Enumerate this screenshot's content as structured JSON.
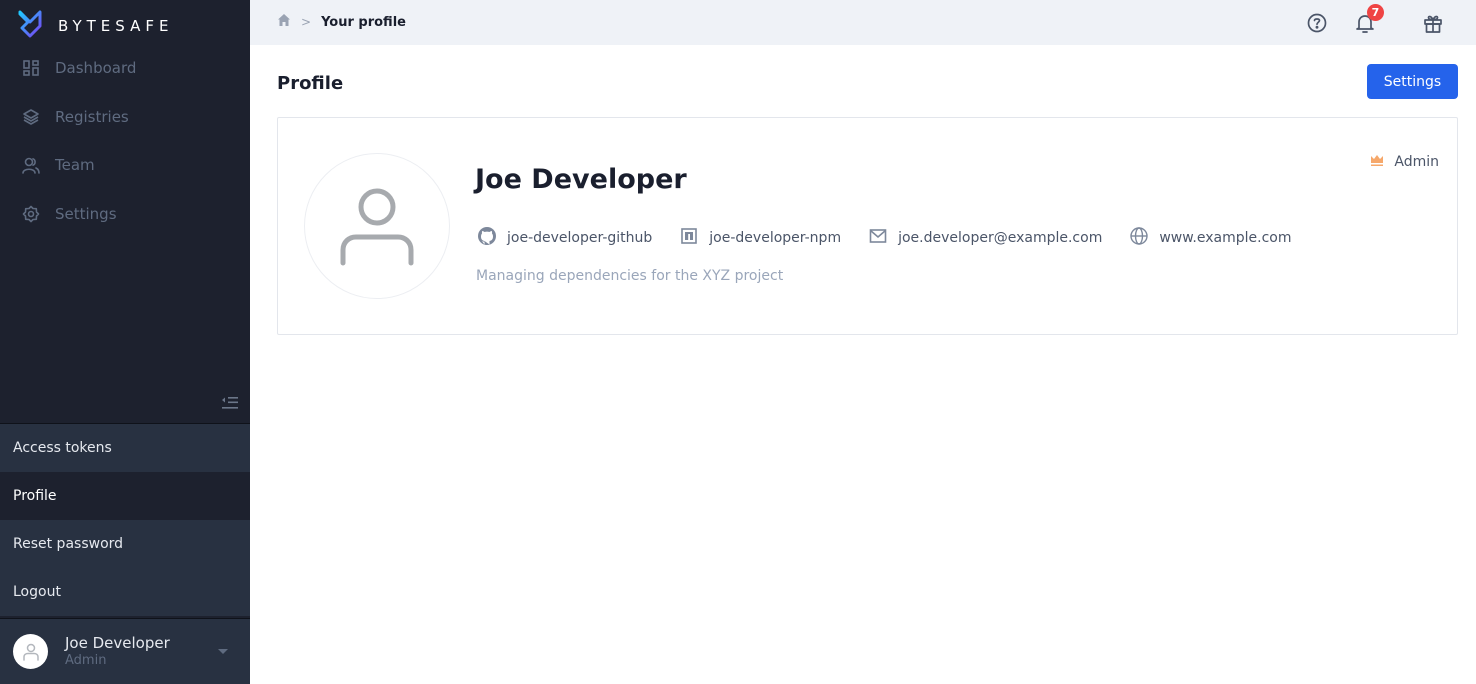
{
  "app": {
    "name": "BYTESAFE",
    "brand_colors": {
      "logo_start": "#1fc8ff",
      "logo_end": "#7b3ff2",
      "sidebar_bg": "#1d212e",
      "primary": "#2563eb",
      "badge": "#ef4444",
      "admin_icon": "#f6a86b"
    }
  },
  "sidebar": {
    "nav": [
      {
        "label": "Dashboard",
        "icon": "dashboard-icon"
      },
      {
        "label": "Registries",
        "icon": "layers-icon"
      },
      {
        "label": "Team",
        "icon": "team-icon"
      },
      {
        "label": "Settings",
        "icon": "gear-icon"
      }
    ],
    "collapse_icon": "collapse-sidebar-icon",
    "user_menu": [
      {
        "label": "Access tokens",
        "active": false
      },
      {
        "label": "Profile",
        "active": true
      },
      {
        "label": "Reset password",
        "active": false
      },
      {
        "label": "Logout",
        "active": false
      }
    ],
    "user": {
      "name": "Joe Developer",
      "role": "Admin"
    }
  },
  "topbar": {
    "breadcrumb": {
      "home_icon": "home-icon",
      "separator": ">",
      "current": "Your profile"
    },
    "icons": [
      "help-icon",
      "bell-icon",
      "gift-icon"
    ],
    "notification_count": "7"
  },
  "main": {
    "title": "Profile",
    "settings_label": "Settings",
    "profile": {
      "name": "Joe Developer",
      "role": "Admin",
      "github": "joe-developer-github",
      "npm": "joe-developer-npm",
      "email": "joe.developer@example.com",
      "website": "www.example.com",
      "bio": "Managing dependencies for the XYZ project"
    }
  }
}
